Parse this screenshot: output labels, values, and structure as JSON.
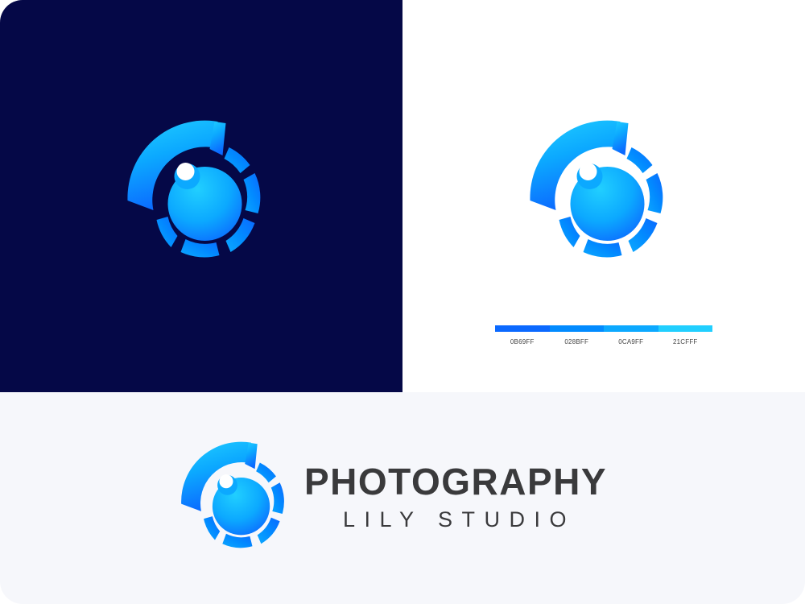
{
  "brand": {
    "title": "PHOTOGRAPHY",
    "subtitle": "LILY STUDIO"
  },
  "palette": [
    {
      "code": "0B69FF",
      "color": "#0B69FF"
    },
    {
      "code": "028BFF",
      "color": "#028BFF"
    },
    {
      "code": "0CA9FF",
      "color": "#0CA9FF"
    },
    {
      "code": "21CFFF",
      "color": "#21CFFF"
    }
  ],
  "colors": {
    "dark_background": "#050847",
    "light_background": "#ffffff",
    "bottom_background": "#f6f7fb",
    "wordmark_text": "#3a3a3c"
  },
  "icons": [
    "camera-lens-logo-icon"
  ]
}
